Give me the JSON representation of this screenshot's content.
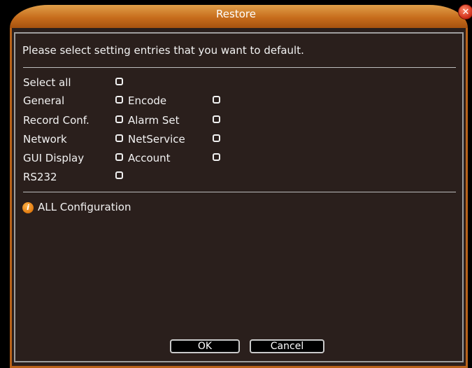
{
  "dialog": {
    "title": "Restore",
    "close_glyph": "✕",
    "instruction": "Please select setting entries that you want to default."
  },
  "options": {
    "select_all": "Select all",
    "general": "General",
    "encode": "Encode",
    "record_conf": "Record Conf.",
    "alarm_set": "Alarm Set",
    "network": "Network",
    "netservice": "NetService",
    "gui_display": "GUI Display",
    "account": "Account",
    "rs232": "RS232"
  },
  "info": {
    "icon": "info-icon",
    "text": "ALL Configuration"
  },
  "buttons": {
    "ok": "OK",
    "cancel": "Cancel"
  },
  "colors": {
    "accent": "#c76d1c",
    "panel": "#2a1f1c"
  }
}
